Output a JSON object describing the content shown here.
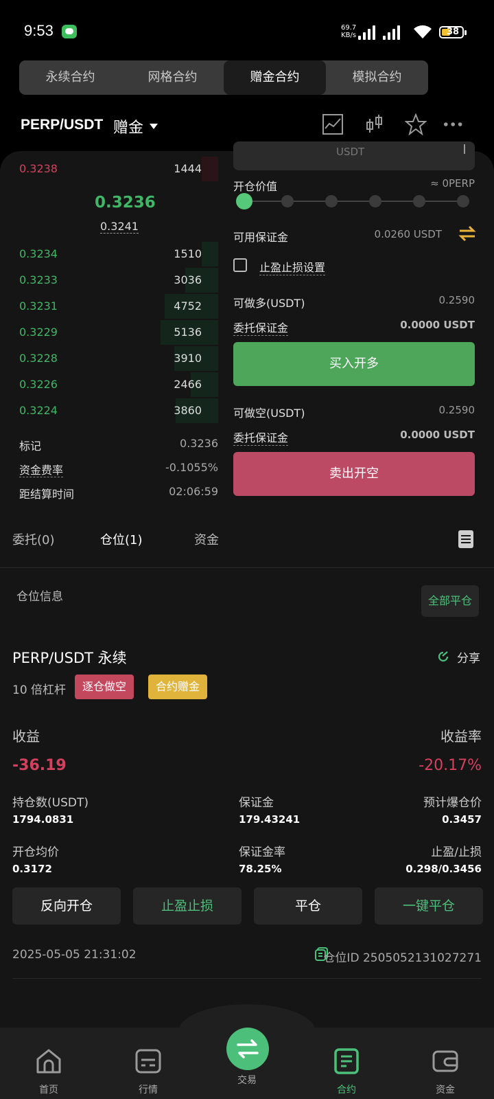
{
  "status_bar": {
    "time": "9:53",
    "net_speed_value": "69.7",
    "net_speed_unit": "KB/s",
    "battery": "38"
  },
  "top_tabs": [
    "永续合约",
    "网格合约",
    "赠金合约",
    "模拟合约"
  ],
  "pair": {
    "symbol": "PERP/USDT",
    "sub": "赠金"
  },
  "order_book": {
    "asks": [
      {
        "price": "0.3238",
        "qty": "1444"
      }
    ],
    "last_price": "0.3236",
    "mark_price": "0.3241",
    "bids": [
      {
        "price": "0.3234",
        "qty": "1510"
      },
      {
        "price": "0.3233",
        "qty": "3036"
      },
      {
        "price": "0.3231",
        "qty": "4752"
      },
      {
        "price": "0.3229",
        "qty": "5136"
      },
      {
        "price": "0.3228",
        "qty": "3910"
      },
      {
        "price": "0.3226",
        "qty": "2466"
      },
      {
        "price": "0.3224",
        "qty": "3860"
      }
    ],
    "info": [
      {
        "label": "标记",
        "value": "0.3236"
      },
      {
        "label": "资金费率",
        "value": "-0.1055%"
      },
      {
        "label": "距结算时间",
        "value": "02:06:59"
      }
    ]
  },
  "trade": {
    "input_unit": "USDT",
    "open_value_label": "开仓价值",
    "open_value": "≈ 0PERP",
    "available_margin_label": "可用保证金",
    "available_margin": "0.0260 USDT",
    "tpsl_label": "止盈止损设置",
    "long_capacity_label": "可做多(USDT)",
    "long_capacity": "0.2590",
    "order_margin_label": "委托保证金",
    "order_margin_long": "0.0000 USDT",
    "buy_label": "买入开多",
    "short_capacity_label": "可做空(USDT)",
    "short_capacity": "0.2590",
    "order_margin_short": "0.0000 USDT",
    "sell_label": "卖出开空"
  },
  "order_tabs": [
    "委托(0)",
    "仓位(1)",
    "资金"
  ],
  "position": {
    "section_title": "仓位信息",
    "close_all": "全部平仓",
    "name": "PERP/USDT 永续",
    "share": "分享",
    "leverage": "10 倍杠杆",
    "badge_side": "逐仓做空",
    "badge_bonus": "合约赠金",
    "pnl_label": "收益",
    "pnl": "-36.19",
    "roe_label": "收益率",
    "roe": "-20.17%",
    "size_label": "持仓数(USDT)",
    "size": "1794.0831",
    "margin_label": "保证金",
    "margin": "179.43241",
    "liq_label": "预计爆仓价",
    "liq": "0.3457",
    "entry_label": "开仓均价",
    "entry": "0.3172",
    "margin_ratio_label": "保证金率",
    "margin_ratio": "78.25%",
    "tpsl_label": "止盈/止损",
    "tpsl": "0.298/0.3456",
    "buttons": [
      "反向开仓",
      "止盈止损",
      "平仓",
      "一键平仓"
    ],
    "time": "2025-05-05 21:31:02",
    "id_label": "仓位ID 2505052131027271"
  },
  "nav": [
    "首页",
    "行情",
    "交易",
    "合约",
    "资金"
  ],
  "colors": {
    "green": "#3fb766",
    "red": "#d4415f",
    "accent": "#4cc07a"
  }
}
